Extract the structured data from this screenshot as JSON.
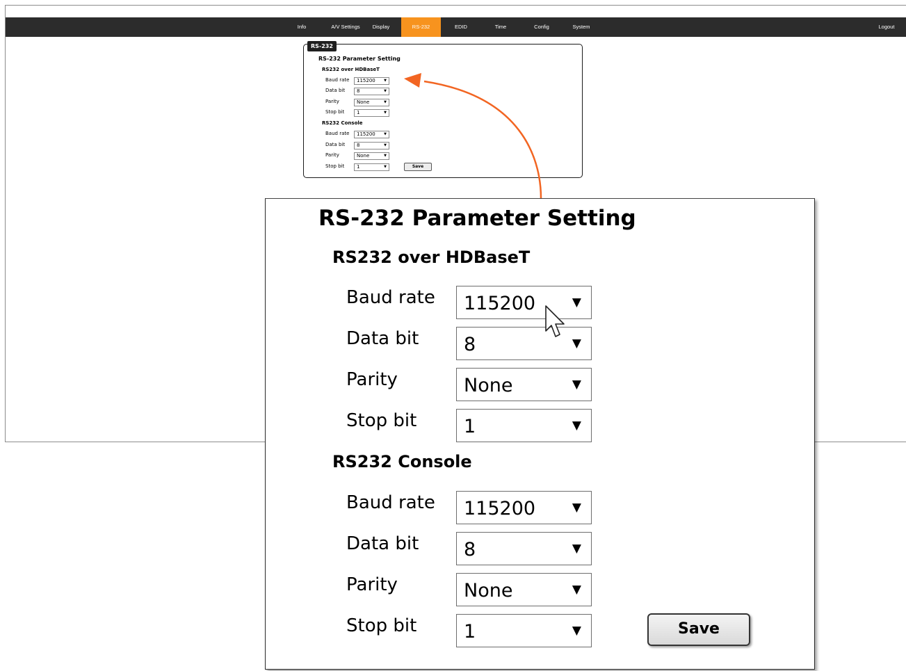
{
  "nav": {
    "items": [
      {
        "label": "Info"
      },
      {
        "label": "A/V Settings"
      },
      {
        "label": "Display"
      },
      {
        "label": "RS-232"
      },
      {
        "label": "EDID"
      },
      {
        "label": "Time"
      },
      {
        "label": "Config"
      },
      {
        "label": "System"
      }
    ],
    "active": "RS-232",
    "logout": "Logout"
  },
  "colors": {
    "navbar": "#2c2c2c",
    "active_tab": "#f7931e",
    "arrow": "#f26522"
  },
  "panel": {
    "tab_label": "RS-232",
    "title": "RS-232 Parameter Setting",
    "sections": [
      {
        "heading": "RS232 over HDBaseT",
        "fields": [
          {
            "label": "Baud rate",
            "value": "115200"
          },
          {
            "label": "Data bit",
            "value": "8"
          },
          {
            "label": "Parity",
            "value": "None"
          },
          {
            "label": "Stop bit",
            "value": "1"
          }
        ]
      },
      {
        "heading": "RS232 Console",
        "fields": [
          {
            "label": "Baud rate",
            "value": "115200"
          },
          {
            "label": "Data bit",
            "value": "8"
          },
          {
            "label": "Parity",
            "value": "None"
          },
          {
            "label": "Stop bit",
            "value": "1"
          }
        ]
      }
    ],
    "save_label": "Save"
  },
  "icons": {
    "dropdown": "down-triangle",
    "pointer": "mouse-pointer-icon"
  }
}
